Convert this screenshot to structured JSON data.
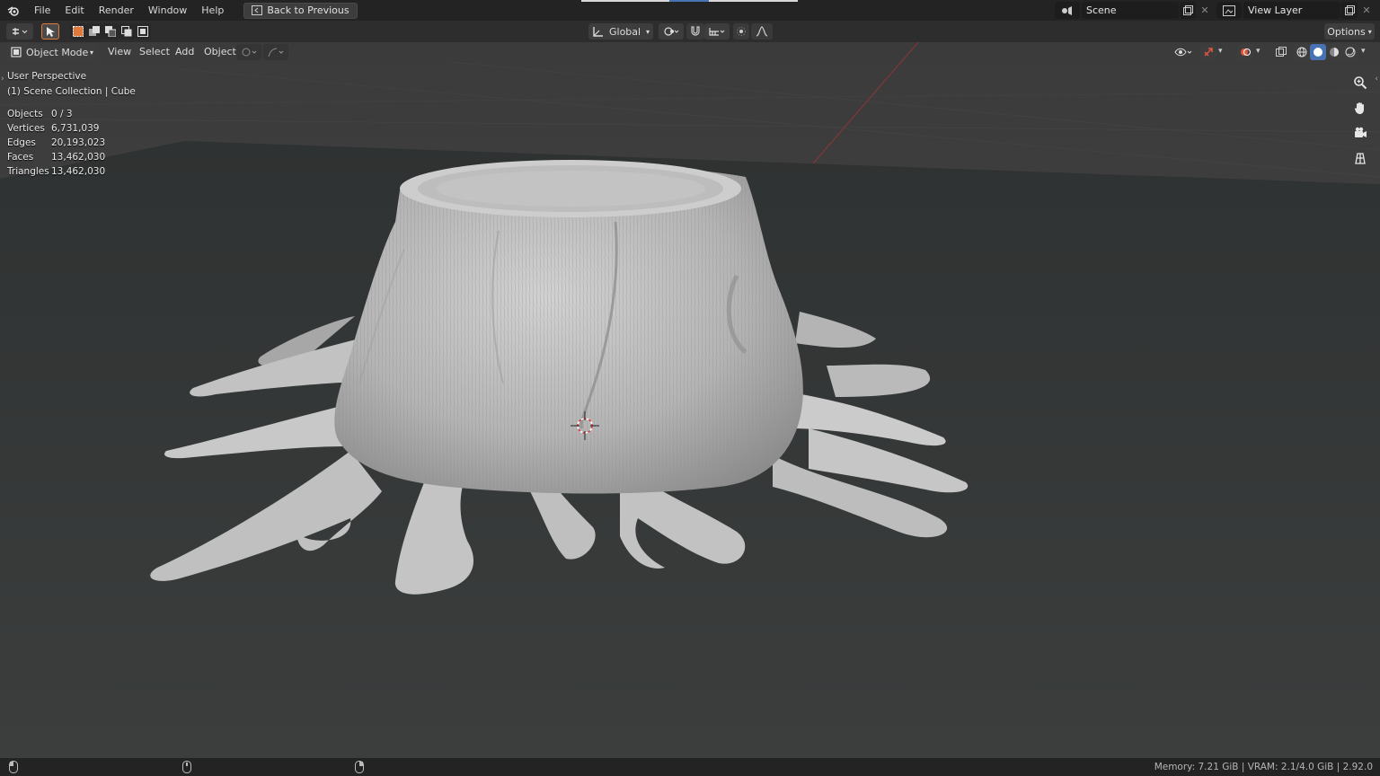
{
  "menubar": {
    "items": [
      "File",
      "Edit",
      "Render",
      "Window",
      "Help"
    ],
    "back_button": "Back to Previous",
    "scene_name": "Scene",
    "view_layer_name": "View Layer"
  },
  "toolheader": {
    "orientation": "Global",
    "options_label": "Options"
  },
  "viewport_header": {
    "mode": "Object Mode",
    "menus": [
      "View",
      "Select",
      "Add",
      "Object"
    ]
  },
  "overlay": {
    "perspective": "User Perspective",
    "collection": "(1) Scene Collection | Cube",
    "stats": [
      {
        "label": "Objects",
        "value": "0 / 3"
      },
      {
        "label": "Vertices",
        "value": "6,731,039"
      },
      {
        "label": "Edges",
        "value": "20,193,023"
      },
      {
        "label": "Faces",
        "value": "13,462,030"
      },
      {
        "label": "Triangles",
        "value": "13,462,030"
      }
    ]
  },
  "statusbar": {
    "info": "Memory: 7.21 GiB | VRAM: 2.1/4.0 GiB | 2.92.0"
  },
  "colors": {
    "accent": "#4772b3",
    "active_tool": "#e07a3c",
    "mesh": "#b9b9b9"
  }
}
